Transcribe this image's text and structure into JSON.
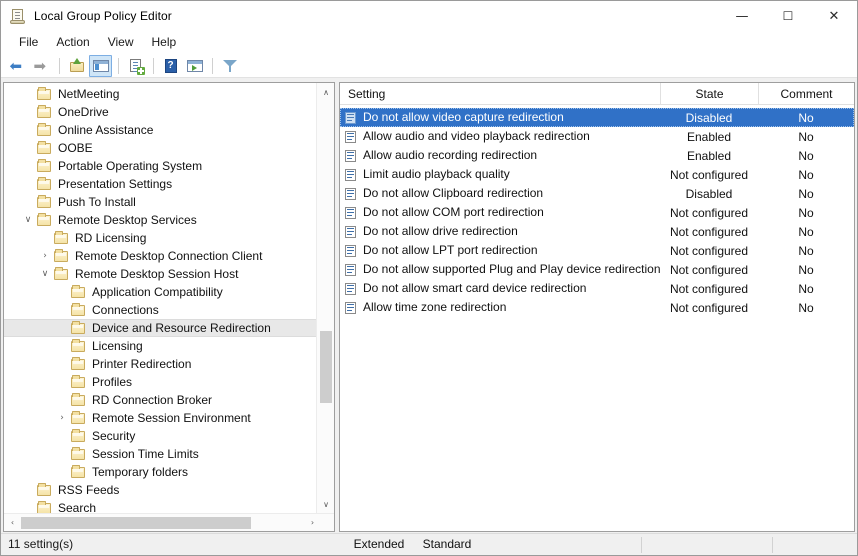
{
  "window": {
    "title": "Local Group Policy Editor",
    "icon": "mmc-console-icon",
    "minimize_label": "—",
    "maximize_label": "☐",
    "close_label": "✕"
  },
  "menubar": {
    "items": [
      {
        "label": "File"
      },
      {
        "label": "Action"
      },
      {
        "label": "View"
      },
      {
        "label": "Help"
      }
    ]
  },
  "toolbar": {
    "buttons": [
      {
        "name": "back-arrow-icon",
        "glyph": "←",
        "active": false
      },
      {
        "name": "forward-arrow-icon",
        "glyph": "→",
        "active": false
      },
      {
        "name": "up-one-level-icon",
        "glyph": "",
        "active": false
      },
      {
        "name": "show-hide-tree-icon",
        "glyph": "",
        "active": true
      },
      {
        "name": "properties-icon",
        "glyph": "",
        "active": false
      },
      {
        "name": "help-icon",
        "glyph": "?",
        "active": false
      },
      {
        "name": "export-list-icon",
        "glyph": "",
        "active": false
      },
      {
        "name": "filter-icon",
        "glyph": "",
        "active": false
      }
    ]
  },
  "tree": {
    "items": [
      {
        "label": "NetMeeting",
        "indent": 2,
        "chevron": "",
        "selected": false
      },
      {
        "label": "OneDrive",
        "indent": 2,
        "chevron": "",
        "selected": false
      },
      {
        "label": "Online Assistance",
        "indent": 2,
        "chevron": "",
        "selected": false
      },
      {
        "label": "OOBE",
        "indent": 2,
        "chevron": "",
        "selected": false
      },
      {
        "label": "Portable Operating System",
        "indent": 2,
        "chevron": "",
        "selected": false
      },
      {
        "label": "Presentation Settings",
        "indent": 2,
        "chevron": "",
        "selected": false
      },
      {
        "label": "Push To Install",
        "indent": 2,
        "chevron": "",
        "selected": false
      },
      {
        "label": "Remote Desktop Services",
        "indent": 2,
        "chevron": "∨",
        "selected": false
      },
      {
        "label": "RD Licensing",
        "indent": 3,
        "chevron": "",
        "selected": false
      },
      {
        "label": "Remote Desktop Connection Client",
        "indent": 3,
        "chevron": "›",
        "selected": false
      },
      {
        "label": "Remote Desktop Session Host",
        "indent": 3,
        "chevron": "∨",
        "selected": false
      },
      {
        "label": "Application Compatibility",
        "indent": 4,
        "chevron": "",
        "selected": false
      },
      {
        "label": "Connections",
        "indent": 4,
        "chevron": "",
        "selected": false
      },
      {
        "label": "Device and Resource Redirection",
        "indent": 4,
        "chevron": "",
        "selected": true
      },
      {
        "label": "Licensing",
        "indent": 4,
        "chevron": "",
        "selected": false
      },
      {
        "label": "Printer Redirection",
        "indent": 4,
        "chevron": "",
        "selected": false
      },
      {
        "label": "Profiles",
        "indent": 4,
        "chevron": "",
        "selected": false
      },
      {
        "label": "RD Connection Broker",
        "indent": 4,
        "chevron": "",
        "selected": false
      },
      {
        "label": "Remote Session Environment",
        "indent": 4,
        "chevron": "›",
        "selected": false
      },
      {
        "label": "Security",
        "indent": 4,
        "chevron": "",
        "selected": false
      },
      {
        "label": "Session Time Limits",
        "indent": 4,
        "chevron": "",
        "selected": false
      },
      {
        "label": "Temporary folders",
        "indent": 4,
        "chevron": "",
        "selected": false
      },
      {
        "label": "RSS Feeds",
        "indent": 2,
        "chevron": "",
        "selected": false
      },
      {
        "label": "Search",
        "indent": 2,
        "chevron": "",
        "selected": false
      }
    ],
    "scroll_up_glyph": "∧",
    "scroll_down_glyph": "∨",
    "scroll_left_glyph": "‹",
    "scroll_right_glyph": "›"
  },
  "listview": {
    "columns": [
      {
        "label": "Setting"
      },
      {
        "label": "State"
      },
      {
        "label": "Comment"
      }
    ],
    "rows": [
      {
        "setting": "Do not allow video capture redirection",
        "state": "Disabled",
        "comment": "No",
        "selected": true
      },
      {
        "setting": "Allow audio and video playback redirection",
        "state": "Enabled",
        "comment": "No",
        "selected": false
      },
      {
        "setting": "Allow audio recording redirection",
        "state": "Enabled",
        "comment": "No",
        "selected": false
      },
      {
        "setting": "Limit audio playback quality",
        "state": "Not configured",
        "comment": "No",
        "selected": false
      },
      {
        "setting": "Do not allow Clipboard redirection",
        "state": "Disabled",
        "comment": "No",
        "selected": false
      },
      {
        "setting": "Do not allow COM port redirection",
        "state": "Not configured",
        "comment": "No",
        "selected": false
      },
      {
        "setting": "Do not allow drive redirection",
        "state": "Not configured",
        "comment": "No",
        "selected": false
      },
      {
        "setting": "Do not allow LPT port redirection",
        "state": "Not configured",
        "comment": "No",
        "selected": false
      },
      {
        "setting": "Do not allow supported Plug and Play device redirection",
        "state": "Not configured",
        "comment": "No",
        "selected": false
      },
      {
        "setting": "Do not allow smart card device redirection",
        "state": "Not configured",
        "comment": "No",
        "selected": false
      },
      {
        "setting": "Allow time zone redirection",
        "state": "Not configured",
        "comment": "No",
        "selected": false
      }
    ]
  },
  "tabs": [
    {
      "label": "Extended",
      "active": false
    },
    {
      "label": "Standard",
      "active": true
    }
  ],
  "statusbar": {
    "text": "11 setting(s)"
  },
  "colors": {
    "selection_blue": "#3071c7",
    "tree_selection_gray": "#e8e8e8",
    "window_bg": "#f0f0f0",
    "pane_bg": "#ffffff"
  }
}
